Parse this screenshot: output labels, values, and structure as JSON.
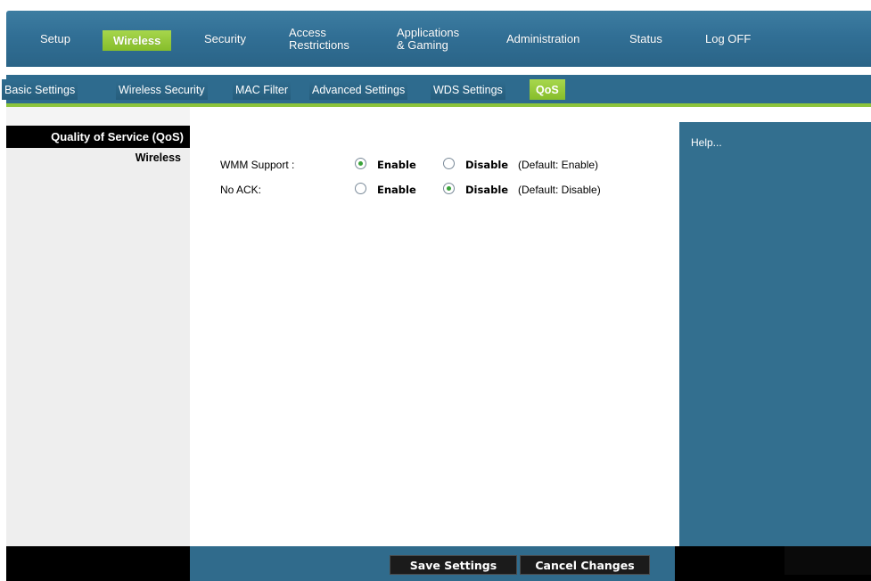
{
  "nav": {
    "items": [
      {
        "label": "Setup"
      },
      {
        "label": "Wireless"
      },
      {
        "label": "Security"
      },
      {
        "label_line1": "Access",
        "label_line2": "Restrictions"
      },
      {
        "label_line1": "Applications",
        "label_line2": "& Gaming"
      },
      {
        "label": "Administration"
      },
      {
        "label": "Status"
      },
      {
        "label": "Log OFF"
      }
    ],
    "active": "Wireless"
  },
  "subnav": {
    "tabs": [
      {
        "label": "Basic Settings"
      },
      {
        "label": "Wireless Security"
      },
      {
        "label": "MAC Filter"
      },
      {
        "label": "Advanced Settings"
      },
      {
        "label": "WDS Settings"
      },
      {
        "label": "QoS"
      }
    ],
    "active": "QoS"
  },
  "left": {
    "section_title": "Quality of Service (QoS)",
    "section_sub": "Wireless"
  },
  "form": {
    "rows": [
      {
        "label": "WMM Support :",
        "enable_label": "Enable",
        "disable_label": "Disable",
        "default_text": "(Default: Enable)",
        "selected": "Enable"
      },
      {
        "label": "No ACK:",
        "enable_label": "Enable",
        "disable_label": "Disable",
        "default_text": "(Default: Disable)",
        "selected": "Disable"
      }
    ]
  },
  "help": {
    "text": "Help..."
  },
  "buttons": {
    "save": "Save Settings",
    "cancel": "Cancel Changes"
  },
  "colors": {
    "nav_blue": "#316f95",
    "accent_green": "#8cc43c",
    "help_blue": "#336f8f",
    "radio_checked": "#3aa33a"
  }
}
